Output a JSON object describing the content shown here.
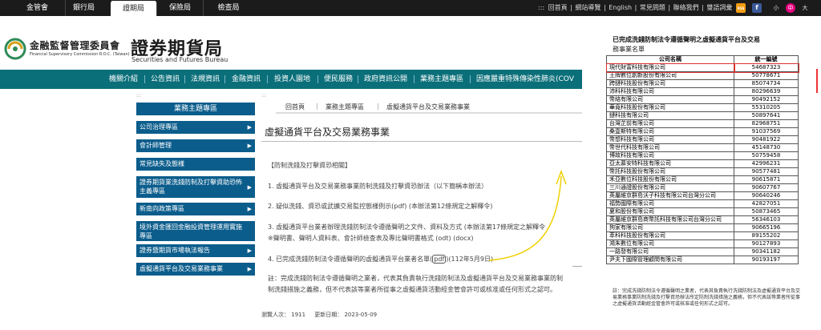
{
  "topbar": {
    "tabs": [
      "金管會",
      "銀行局",
      "證期局",
      "保險局",
      "檢查局"
    ],
    "links": [
      "回首頁",
      "網站導覽",
      "English",
      "常見問題",
      "聯絡我們",
      "雙語詞彙"
    ],
    "rss_label": "RSS",
    "font_small": "小",
    "font_mid": "中",
    "font_large": "大"
  },
  "header": {
    "org_zh": "金融監督管理委員會",
    "org_en": "Financial Supervisory Commission R.O.C. (Taiwan)",
    "bureau_zh": "證券期貨局",
    "bureau_en": "Securities and Futures Bureau"
  },
  "mainnav": [
    "機關介紹",
    "公告資訊",
    "法規資訊",
    "金融資訊",
    "投資人園地",
    "便民服務",
    "政府資訊公開",
    "業務主題專區",
    "因應嚴重特殊傳染性肺炎(COV"
  ],
  "sidebar": {
    "dots": ":::",
    "title": "業務主題專區",
    "items": [
      "公司治理專區",
      "會計師管理",
      "常見缺失及態樣",
      "證券期貨業洗錢防制及打擊資助恐怖主義專區",
      "新南向政策專區",
      "境外資金匯回金融投資管理運用實施專區",
      "證券暨期貨市場執法報告",
      "虛擬通貨平台及交易業務事業"
    ]
  },
  "breadcrumb": {
    "dots": ":::",
    "items": [
      "回首頁",
      "業務主題專區",
      "虛擬通貨平台及交易業務事業"
    ]
  },
  "content": {
    "title": "虛擬通貨平台及交易業務事業",
    "section": "【防制洗錢及打擊資恐相關】",
    "item1": "1. 虛擬通貨平台及交易業務事業防制洗錢及打擊資恐辦法（以下簡稱本辦法）",
    "item2": "2. 疑似洗錢、資恐或武擴交易監控態樣例示(pdf) (本辦法第12條規定之解釋令)",
    "item3a": "3. 虛擬通貨平台業者辦理洗錢防制法令遵循聲明之文件、資料及方式 (本辦法第17條規定之解釋令",
    "item3b": "※聲明書、聲明人資料表、會計師檢查表及專比聲明書格式 (odt) (docx)",
    "item4a": "4. 已完成洗錢防制法令遵循聲明的虛擬通貨平台業者名單(",
    "item4_pdf": "pdf",
    "item4b": ")(112年5月9日)",
    "note1": "註：完成洗錢防制法令遵循聲明之業者，代表其負責執行洗錢防制法及虛擬通貨平台及交易業務事業防制",
    "note2": "制洗錢措施之義務，但不代表該等業者所從事之虛擬通貨活動經金管會許可或核准或任何形式之認可。",
    "visits_label": "瀏覽人次：",
    "visits": "1911",
    "updated_label": "更新日期：",
    "updated": "2023-05-09"
  },
  "right_panel": {
    "title": "已完成洗錢防制法令遵循聲明之虛擬通貨平台及交易",
    "subtitle": "務事業名單",
    "col_company": "公司名稱",
    "col_id": "統一編號",
    "rows": [
      [
        "現代財富科技有限公司",
        "54687323"
      ],
      [
        "王牌數位創新股份有限公司",
        "50778671"
      ],
      [
        "跨鏈科技股份有限公司",
        "85074734"
      ],
      [
        "沛科科技有限公司",
        "80296639"
      ],
      [
        "幣絡有限公司",
        "90492152"
      ],
      [
        "華竟科技股份有限公司",
        "55310205"
      ],
      [
        "鏈科技有限公司",
        "50897641"
      ],
      [
        "台灣芷前有限公司",
        "82968751"
      ],
      [
        "桑壹斯特有限公司",
        "91037569"
      ],
      [
        "幣想科技有限公司",
        "90481922"
      ],
      [
        "幣世代科技有限公司",
        "45148730"
      ],
      [
        "博故科技有限公司",
        "50759458"
      ],
      [
        "亞太慕安特科技有限公司",
        "42996231"
      ],
      [
        "幣託科技股份有限公司",
        "90577481"
      ],
      [
        "禾亞數位科技股份有限公司",
        "90615871"
      ],
      [
        "三川通證股份有限公司",
        "90607767"
      ],
      [
        "英屬維京群島沃子科技有限公司台灣分公司",
        "90640246"
      ],
      [
        "福勢國際有限公司",
        "42827051"
      ],
      [
        "夏和股份有限公司",
        "50873465"
      ],
      [
        "英屬維京群島商幣託科技有限公司台灣分公司",
        "56346103"
      ],
      [
        "狗家有限公司",
        "90665196"
      ],
      [
        "萃科科技股份有限公司",
        "89155202"
      ],
      [
        "鴻朱數位有限公司",
        "90127893"
      ],
      [
        "一路發有限公司",
        "90341182"
      ],
      [
        "尹夫下國際管理顧問有限公司",
        "90193197"
      ]
    ],
    "note": "註：完成洗錢防制法令遵循聲明之業者，代表其負責執行洗錢防制法及虛擬通貨平台及交易業務事業防制洗錢及打擊資恐辦法所定防制洗錢措施之義務，但不代表該等業者所從事之虛擬通貨活動經金管會許可或核准或任何形式之認可。"
  },
  "colors": {
    "nav_teal": "#0b6f7a",
    "menu_blue": "#0b5d8c",
    "highlight_red": "#d33333",
    "annotation_yellow": "#f0d000"
  }
}
